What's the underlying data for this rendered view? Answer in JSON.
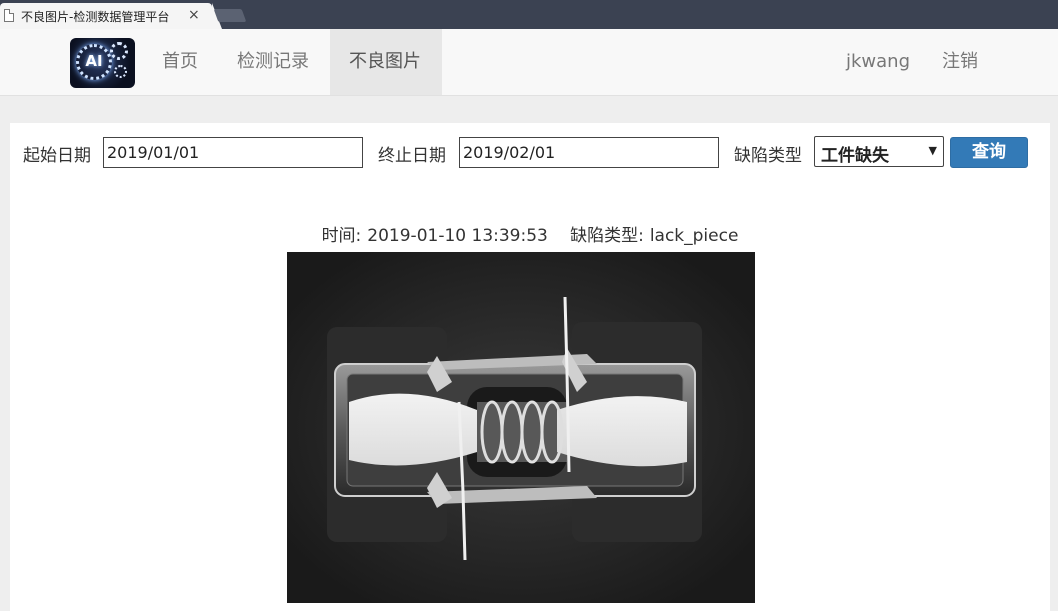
{
  "browser": {
    "tab_title": "不良图片-检测数据管理平台",
    "close_glyph": "×"
  },
  "navbar": {
    "logo_text": "AI",
    "items": [
      {
        "label": "首页"
      },
      {
        "label": "检测记录"
      },
      {
        "label": "不良图片",
        "active": true
      }
    ],
    "user": "jkwang",
    "logout": "注销"
  },
  "filters": {
    "start_label": "起始日期",
    "start_value": "2019/01/01",
    "end_label": "终止日期",
    "end_value": "2019/02/01",
    "defect_label": "缺陷类型",
    "defect_selected": "工件缺失",
    "query_label": "查询"
  },
  "record": {
    "time_label": "时间:",
    "time_value": "2019-01-10 13:39:53",
    "defect_label": "缺陷类型:",
    "defect_value": "lack_piece"
  },
  "colors": {
    "accent": "#337ab7",
    "nav_active_bg": "#e7e7e7",
    "tabstrip": "#3b4252"
  }
}
